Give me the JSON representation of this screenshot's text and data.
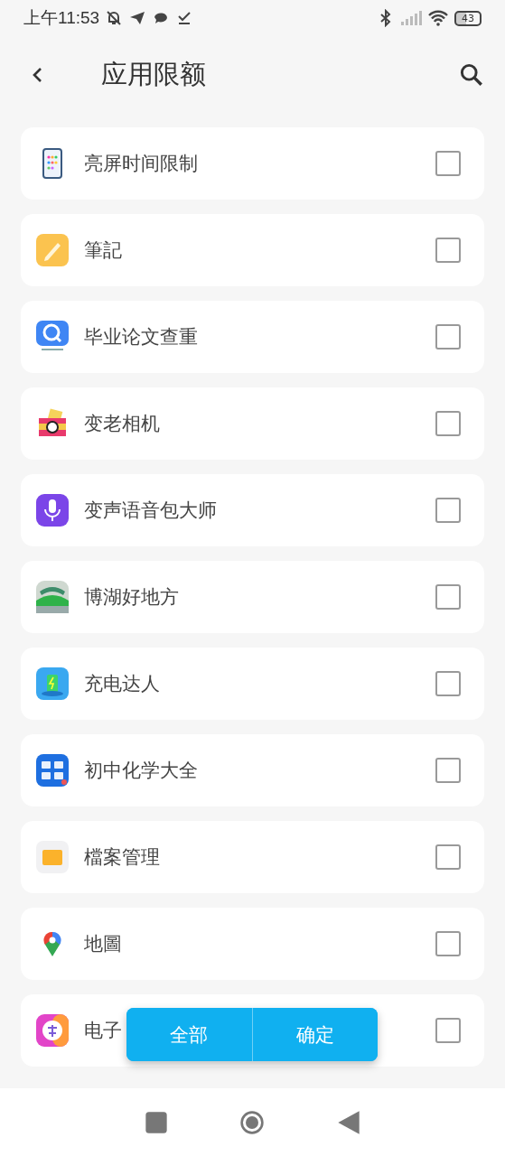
{
  "status_bar": {
    "time": "上午11:53",
    "battery": "43"
  },
  "header": {
    "title": "应用限额"
  },
  "apps": [
    {
      "name": "亮屏时间限制",
      "kind": "phone",
      "checked": false
    },
    {
      "name": "筆記",
      "kind": "notes",
      "checked": false
    },
    {
      "name": "毕业论文查重",
      "kind": "magnifier",
      "checked": false
    },
    {
      "name": "变老相机",
      "kind": "camera",
      "checked": false
    },
    {
      "name": "变声语音包大师",
      "kind": "mic",
      "checked": false
    },
    {
      "name": "博湖好地方",
      "kind": "landscape",
      "checked": false
    },
    {
      "name": "充电达人",
      "kind": "battery",
      "checked": false
    },
    {
      "name": "初中化学大全",
      "kind": "tile",
      "checked": false
    },
    {
      "name": "檔案管理",
      "kind": "folder",
      "checked": false
    },
    {
      "name": "地圖",
      "kind": "pin",
      "checked": false
    },
    {
      "name": "电子",
      "kind": "font",
      "checked": false
    }
  ],
  "actions": [
    "全部",
    "确定"
  ]
}
